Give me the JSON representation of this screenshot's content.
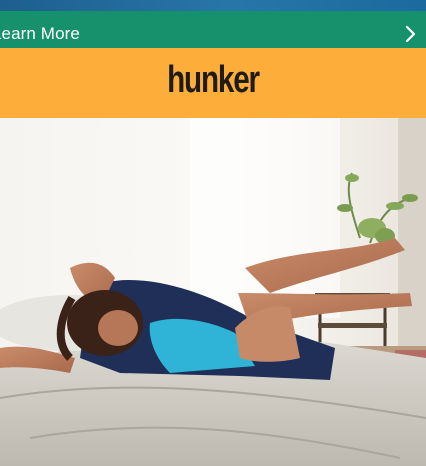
{
  "promo_bar": {
    "label": "Learn More",
    "chevron_icon": "chevron-right-icon",
    "background": "#16916b"
  },
  "brand_bar": {
    "logo_text": "hunker",
    "background": "#fdae3a"
  },
  "hero": {
    "image_icon": "woman-lying-on-bed-photo"
  }
}
